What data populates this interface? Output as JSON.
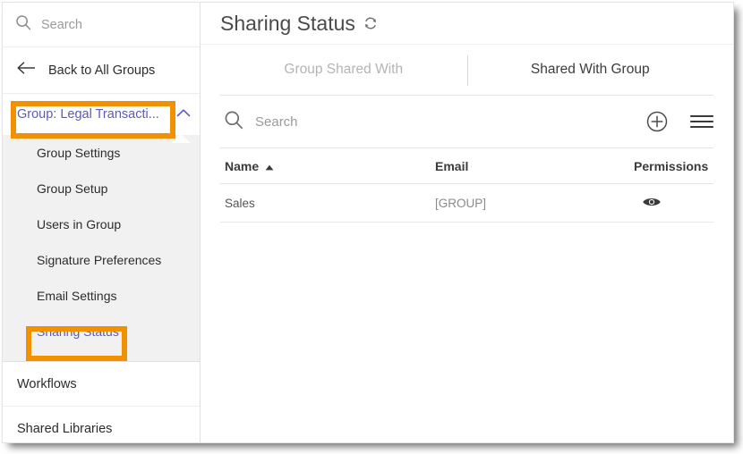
{
  "sidebar": {
    "search": {
      "label": "Search",
      "icon": "search-icon"
    },
    "back": {
      "label": "Back to All Groups",
      "icon": "arrow-left-icon"
    },
    "group": {
      "label": "Group: Legal Transacti...",
      "icon": "chevron-up-icon",
      "color": "#5a5ac0"
    },
    "submenu": [
      {
        "label": "Group Settings",
        "active": false
      },
      {
        "label": "Group Setup",
        "active": false
      },
      {
        "label": "Users in Group",
        "active": false
      },
      {
        "label": "Signature Preferences",
        "active": false
      },
      {
        "label": "Email Settings",
        "active": false
      },
      {
        "label": "Sharing Status",
        "active": true
      }
    ],
    "footer": [
      {
        "label": "Workflows"
      },
      {
        "label": "Shared Libraries"
      }
    ]
  },
  "annotations": {
    "color": "#f29100",
    "boxes": [
      {
        "target": "group-selector",
        "label": "Group: Legal Transacti..."
      },
      {
        "target": "sharing-status-menu-item",
        "label": "Sharing Status"
      }
    ]
  },
  "main": {
    "header": {
      "title": "Sharing Status",
      "refresh_icon": "refresh-icon"
    },
    "tabs": [
      {
        "label": "Group Shared With",
        "active": false
      },
      {
        "label": "Shared With Group",
        "active": true
      }
    ],
    "toolbar": {
      "search_placeholder": "Search",
      "search_value": "",
      "add_icon": "plus-circle-icon",
      "menu_icon": "hamburger-menu-icon"
    },
    "table": {
      "columns": [
        {
          "label": "Name",
          "sort": "ascending",
          "sort_icon": "triangle-up-icon"
        },
        {
          "label": "Email",
          "sort": "none"
        },
        {
          "label": "Permissions",
          "sort": "none"
        }
      ],
      "rows": [
        {
          "name": "Sales",
          "email": "[GROUP]",
          "permission_icon": "eye-icon"
        }
      ]
    }
  }
}
